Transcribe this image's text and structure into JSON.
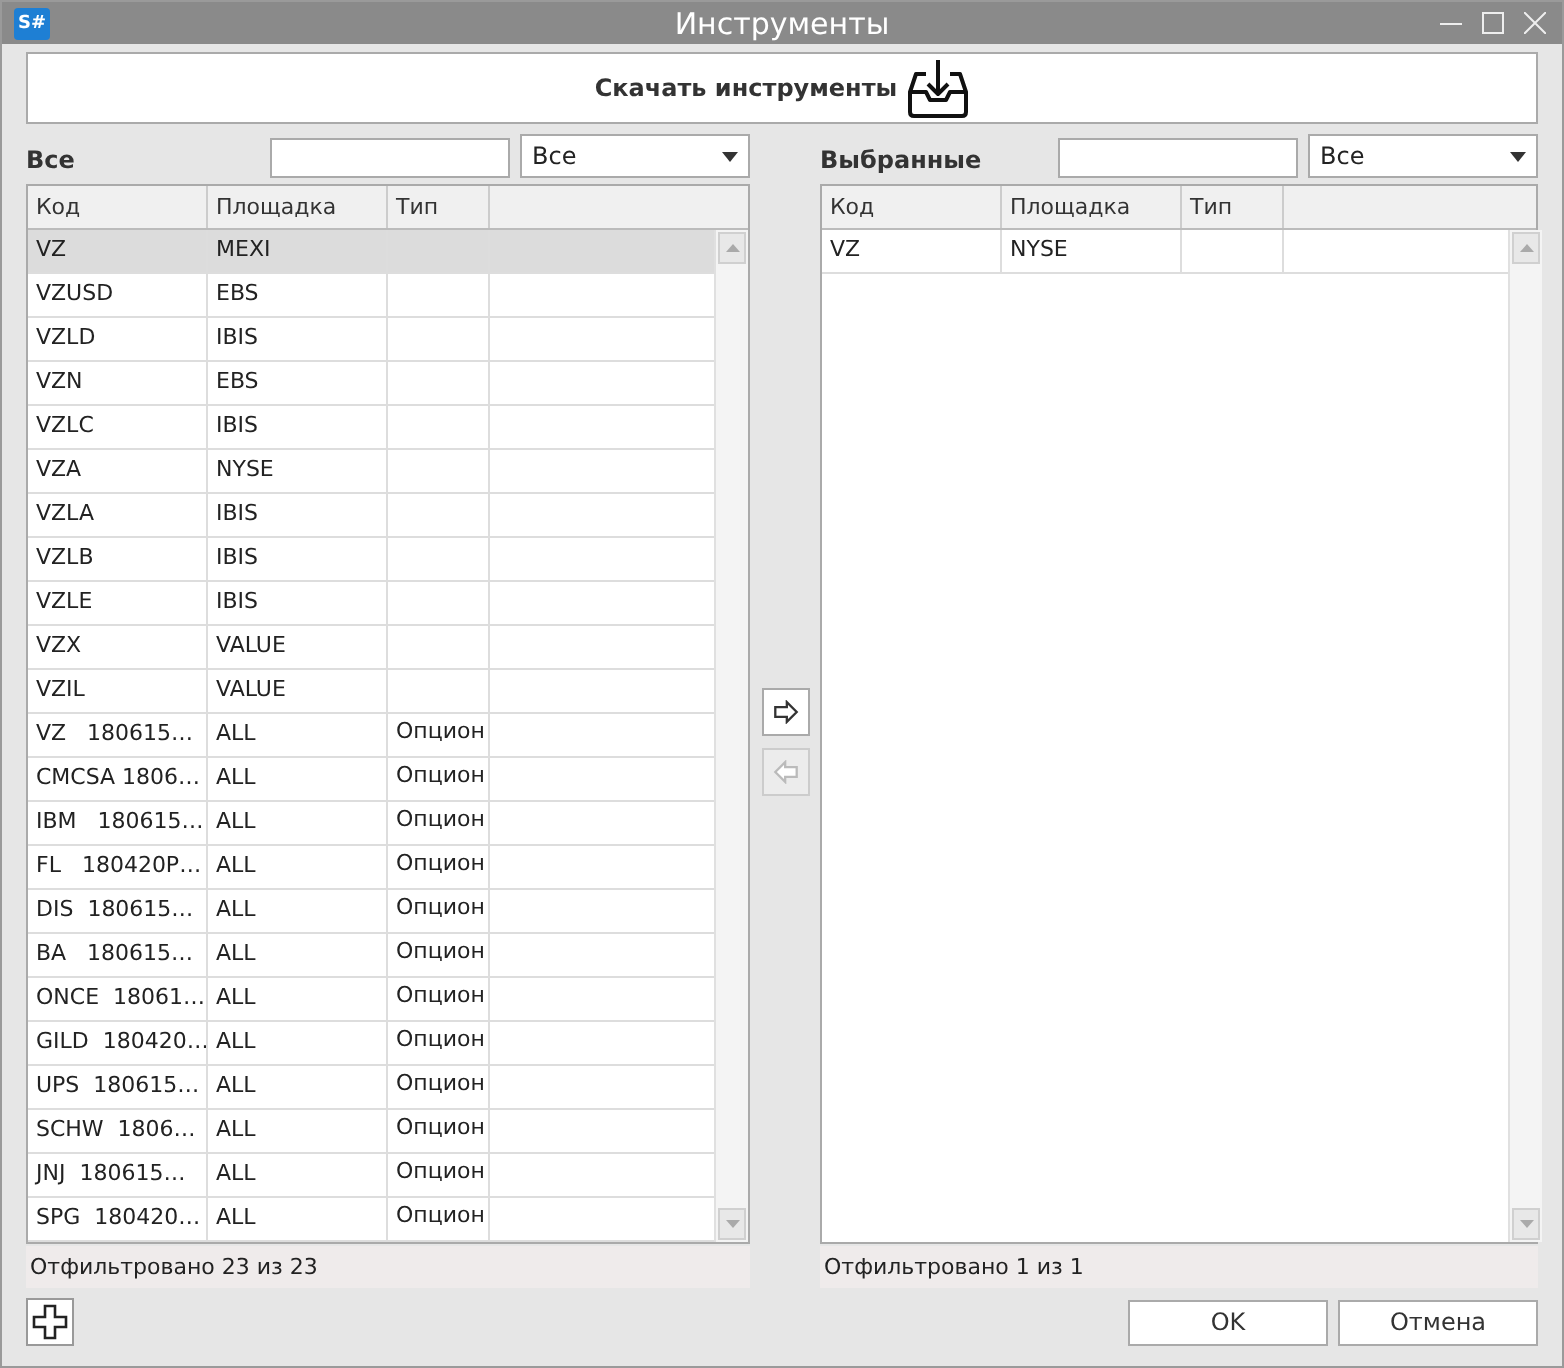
{
  "window": {
    "logo": "S#",
    "title": "Инструменты"
  },
  "download_button": {
    "label": "Скачать инструменты"
  },
  "panels": [
    {
      "title": "Все",
      "filter": {
        "value": "Все"
      },
      "columns": [
        "Код",
        "Площадка",
        "Тип"
      ],
      "rows": [
        {
          "code": "VZ",
          "exchange": "MEXI",
          "selected": true
        },
        {
          "code": "VZUSD",
          "exchange": "EBS",
          "selected": false
        },
        {
          "code": "VZLD",
          "exchange": "IBIS",
          "selected": false
        },
        {
          "code": "VZN",
          "exchange": "EBS",
          "selected": false
        },
        {
          "code": "VZLC",
          "exchange": "IBIS",
          "selected": false
        },
        {
          "code": "VZA",
          "exchange": "NYSE",
          "selected": false
        },
        {
          "code": "VZLA",
          "exchange": "IBIS",
          "selected": false
        },
        {
          "code": "VZLB",
          "exchange": "IBIS",
          "selected": false
        },
        {
          "code": "VZLE",
          "exchange": "IBIS",
          "selected": false
        },
        {
          "code": "VZX",
          "exchange": "VALUE",
          "selected": false
        },
        {
          "code": "VZIL",
          "exchange": "VALUE",
          "selected": false
        },
        {
          "code": "VZ   180615…",
          "exchange": "ALL",
          "type": "Опцион",
          "selected": false
        },
        {
          "code": "CMCSA 1806…",
          "exchange": "ALL",
          "type": "Опцион",
          "selected": false
        },
        {
          "code": "IBM   180615…",
          "exchange": "ALL",
          "type": "Опцион",
          "selected": false
        },
        {
          "code": "FL   180420P…",
          "exchange": "ALL",
          "type": "Опцион",
          "selected": false
        },
        {
          "code": "DIS  180615…",
          "exchange": "ALL",
          "type": "Опцион",
          "selected": false
        },
        {
          "code": "BA   180615…",
          "exchange": "ALL",
          "type": "Опцион",
          "selected": false
        },
        {
          "code": "ONCE  18061…",
          "exchange": "ALL",
          "type": "Опцион",
          "selected": false
        },
        {
          "code": "GILD  180420…",
          "exchange": "ALL",
          "type": "Опцион",
          "selected": false
        },
        {
          "code": "UPS  180615…",
          "exchange": "ALL",
          "type": "Опцион",
          "selected": false
        },
        {
          "code": "SCHW  1806…",
          "exchange": "ALL",
          "type": "Опцион",
          "selected": false
        },
        {
          "code": "JNJ  180615…",
          "exchange": "ALL",
          "type": "Опцион",
          "selected": false
        },
        {
          "code": "SPG  180420…",
          "exchange": "ALL",
          "type": "Опцион",
          "selected": false
        }
      ],
      "status": "Отфильтровано 23 из 23"
    },
    {
      "title": "Выбранные",
      "filter": {
        "value": "Все"
      },
      "columns": [
        "Код",
        "Площадка",
        "Тип"
      ],
      "rows": [
        {
          "code": "VZ",
          "exchange": "NYSE",
          "selected": false
        }
      ],
      "status": "Отфильтровано 1 из 1"
    }
  ],
  "move_buttons": [
    {
      "kind": "right",
      "disabled": false
    },
    {
      "kind": "left",
      "disabled": true
    }
  ],
  "buttons": [
    "OK",
    "Отмена"
  ]
}
